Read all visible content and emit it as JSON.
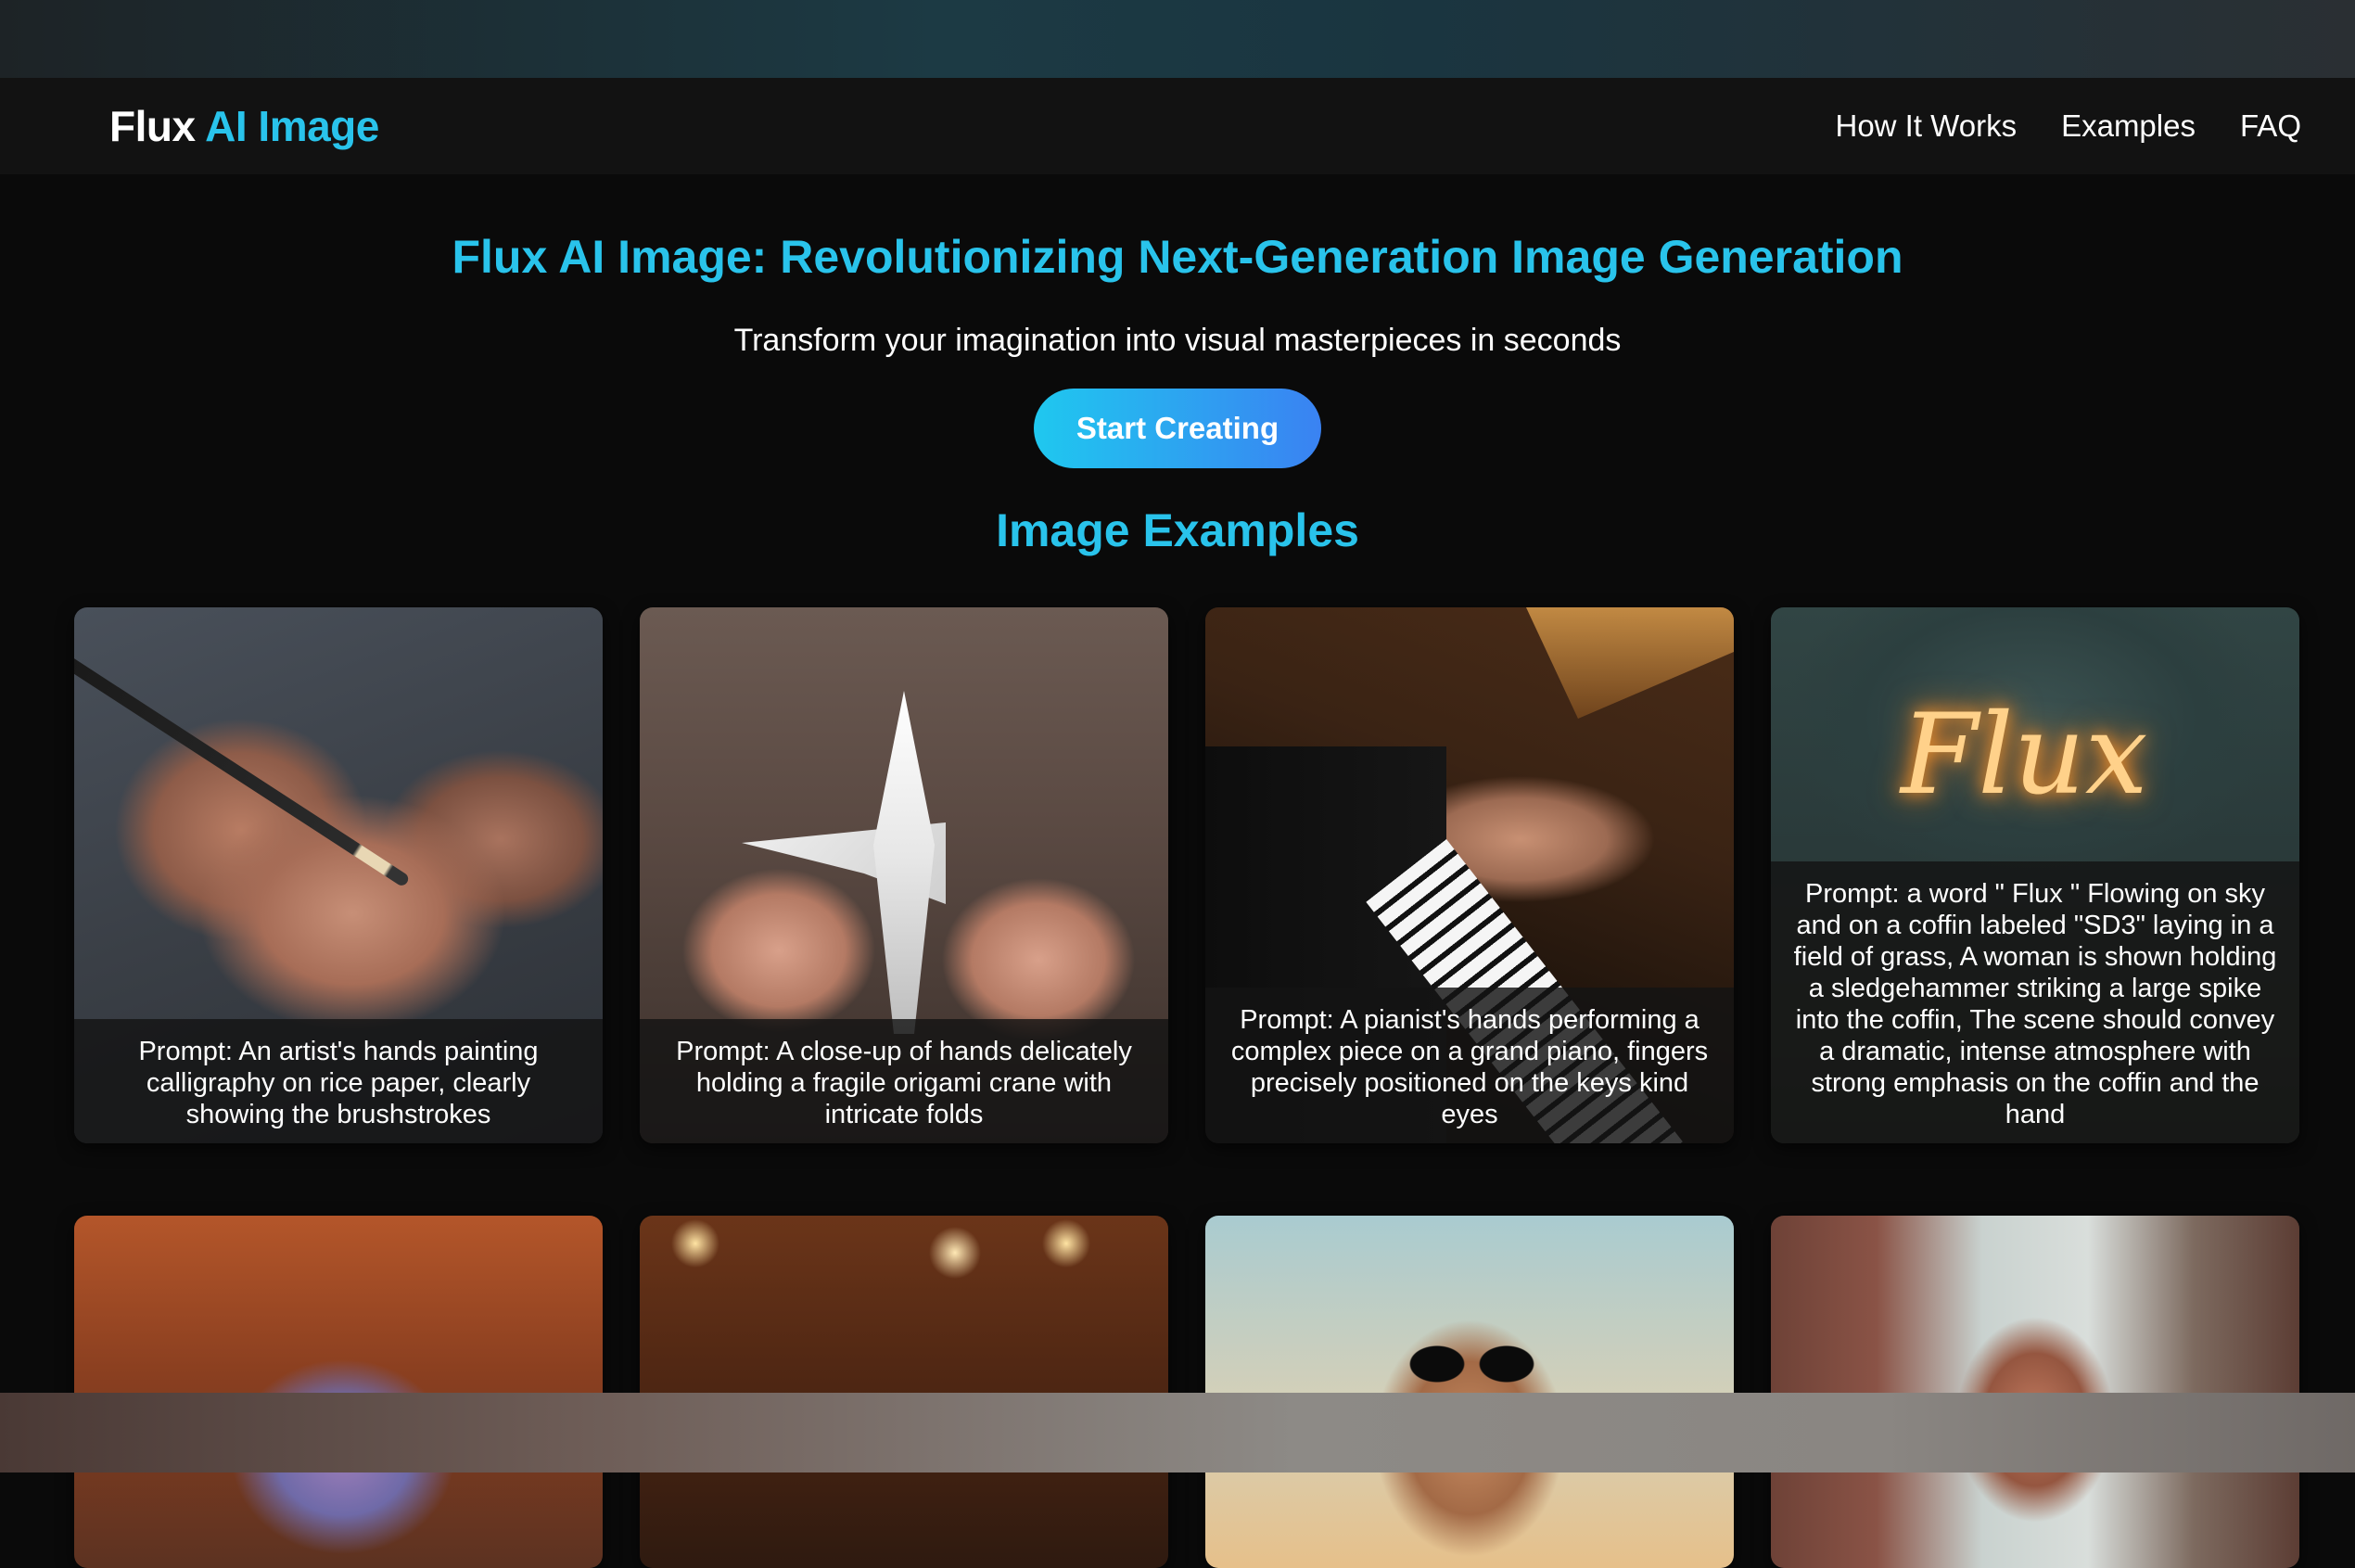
{
  "nav": {
    "logo_part1": "Flux",
    "logo_part2": "AI Image",
    "links": [
      "How It Works",
      "Examples",
      "FAQ"
    ]
  },
  "hero": {
    "title": "Flux AI Image: Revolutionizing Next-Generation Image Generation",
    "subtitle": "Transform your imagination into visual masterpieces in seconds",
    "cta_label": "Start Creating"
  },
  "examples": {
    "section_title": "Image Examples",
    "cards": [
      {
        "caption": "Prompt: An artist's hands painting calligraphy on rice paper, clearly showing the brushstrokes"
      },
      {
        "caption": "Prompt: A close-up of hands delicately holding a fragile origami crane with intricate folds"
      },
      {
        "caption": "Prompt: A pianist's hands performing a complex piece on a grand piano, fingers precisely positioned on the keys kind eyes"
      },
      {
        "caption": "Prompt: a word \" Flux \" Flowing on sky and on a coffin labeled \"SD3\" laying in a field of grass, A woman is shown holding a sledgehammer striking a large spike into the coffin, The scene should convey a dramatic, intense atmosphere with strong emphasis on the coffin and the hand"
      }
    ],
    "card4_glow_text": "Flux"
  },
  "colors": {
    "accent": "#29c3eb",
    "background": "#0a0a0a",
    "nav_background": "#121212",
    "cta_gradient_start": "#1fc8ef",
    "cta_gradient_end": "#3a82f2"
  }
}
